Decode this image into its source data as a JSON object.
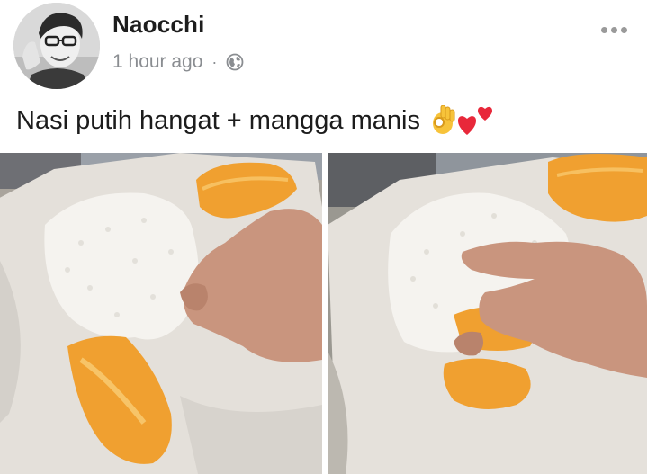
{
  "post": {
    "author": "Naocchi",
    "timestamp": "1 hour ago",
    "separator": "·",
    "privacy_icon": "globe-icon",
    "more_icon": "more-options-icon",
    "caption": "Nasi putih hangat + mangga manis",
    "caption_emojis": [
      "ok-hand-emoji",
      "hearts-emoji"
    ]
  },
  "photos": [
    {
      "name": "rice-and-mango-photo-1"
    },
    {
      "name": "rice-and-mango-photo-2"
    }
  ],
  "colors": {
    "author": "#1d1d1d",
    "meta": "#8a8d91",
    "mango": "#f0a030",
    "rice": "#f4f2ee",
    "paper": "#e9e5df"
  }
}
